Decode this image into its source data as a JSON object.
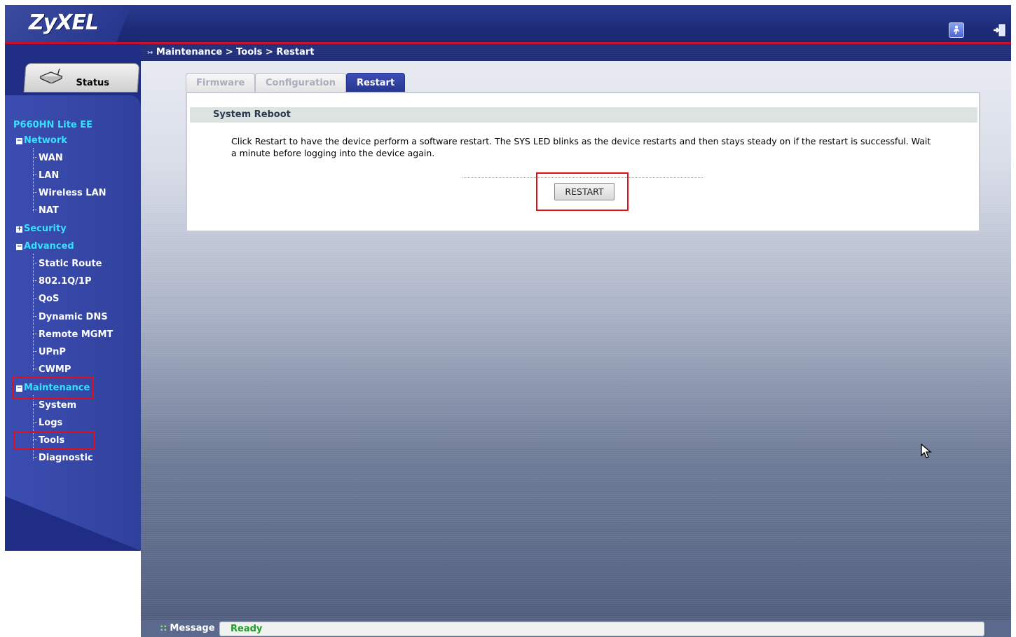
{
  "header": {
    "logo": "ZyXEL",
    "wizard_icon": "wizard-icon",
    "logout_icon": "logout-icon"
  },
  "sidebar": {
    "status_tab": "Status",
    "device_name": "P660HN Lite EE",
    "groups": [
      {
        "label": "Network",
        "expanded": true,
        "items": [
          "WAN",
          "LAN",
          "Wireless LAN",
          "NAT"
        ]
      },
      {
        "label": "Security",
        "expanded": false,
        "items": []
      },
      {
        "label": "Advanced",
        "expanded": true,
        "items": [
          "Static Route",
          "802.1Q/1P",
          "QoS",
          "Dynamic DNS",
          "Remote MGMT",
          "UPnP",
          "CWMP"
        ]
      },
      {
        "label": "Maintenance",
        "expanded": true,
        "items": [
          "System",
          "Logs",
          "Tools",
          "Diagnostic"
        ]
      }
    ]
  },
  "breadcrumb": "Maintenance > Tools > Restart",
  "tabs": [
    {
      "label": "Firmware",
      "active": false
    },
    {
      "label": "Configuration",
      "active": false
    },
    {
      "label": "Restart",
      "active": true
    }
  ],
  "panel": {
    "section_title": "System Reboot",
    "description": "Click Restart to have the device perform a software restart. The SYS LED blinks as the device restarts and then stays steady on if the restart is successful. Wait a minute before logging into the device again.",
    "restart_button": "RESTART"
  },
  "message_bar": {
    "label": "Message",
    "status": "Ready"
  },
  "colors": {
    "accent_cyan": "#38e0ff",
    "header_red_line": "#c8102e",
    "highlight_box": "#e0101a",
    "status_green": "#1c9d2a"
  }
}
